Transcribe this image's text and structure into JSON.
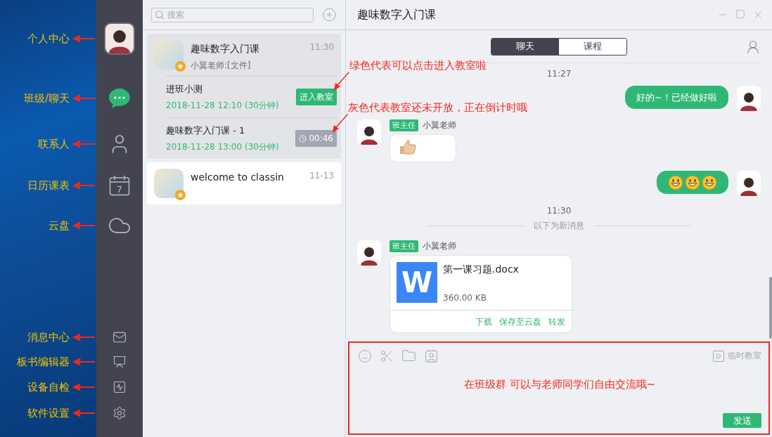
{
  "nav": {
    "items": [
      {
        "kind": "avatar",
        "label": "个人中心",
        "selected": false
      },
      {
        "kind": "chat",
        "label": "班级/聊天",
        "selected": true
      },
      {
        "kind": "contacts",
        "label": "联系人",
        "selected": false
      },
      {
        "kind": "calendar",
        "label": "日历课表",
        "selected": false,
        "text": "7"
      },
      {
        "kind": "cloud",
        "label": "云盘",
        "selected": false
      },
      {
        "kind": "mail",
        "label": "消息中心",
        "selected": false
      },
      {
        "kind": "board",
        "label": "板书编辑器",
        "selected": false
      },
      {
        "kind": "device",
        "label": "设备自检",
        "selected": false
      },
      {
        "kind": "settings",
        "label": "软件设置",
        "selected": false
      }
    ]
  },
  "list": {
    "search": {
      "placeholder": "搜索"
    },
    "conversations": [
      {
        "title": "趣味数字入门课",
        "subtitle": "小翼老师:[文件]",
        "time": "11:30",
        "selected": true,
        "lessons": [
          {
            "title": "进班小测",
            "schedule": "2018-11-28 12:10 (30分钟)",
            "kind": "enter",
            "action": "进入教室"
          },
          {
            "title": "趣味数字入门课 - 1",
            "schedule": "2018-11-28 13:00 (30分钟)",
            "kind": "countdown",
            "action": "00:46"
          }
        ]
      },
      {
        "title": "welcome to classin",
        "time": "11-13",
        "selected": false
      }
    ]
  },
  "callouts": [
    "绿色代表可以点击进入教室啦",
    "灰色代表教室还未开放，正在倒计时哦"
  ],
  "chat": {
    "title": "趣味数字入门课",
    "tabs": [
      {
        "label": "聊天",
        "selected": true
      },
      {
        "label": "课程",
        "selected": false
      }
    ],
    "messages": [
      {
        "kind": "time",
        "text": "11:27"
      },
      {
        "kind": "outgoing_text",
        "text": "好的~！已经做好啦"
      },
      {
        "kind": "incoming_sticker",
        "role": "班主任",
        "sender": "小翼老师"
      },
      {
        "kind": "outgoing_emoji",
        "emojis": [
          {
            "kind": "grin"
          },
          {
            "kind": "grin"
          },
          {
            "kind": "grin"
          }
        ]
      },
      {
        "kind": "time",
        "text": "11:30"
      },
      {
        "kind": "divider",
        "text": "以下为新消息"
      },
      {
        "kind": "incoming_file",
        "role": "班主任",
        "sender": "小翼老师",
        "file": {
          "icon_letter": "W",
          "name": "第一课习题.docx",
          "size": "360.00 KB",
          "actions": [
            "下载",
            "保存至云盘",
            "转发"
          ]
        }
      }
    ]
  },
  "composer": {
    "temp_classroom": "临时教室",
    "callout": "在班级群 可以与老师同学们自由交流哦~",
    "send": "发送"
  }
}
